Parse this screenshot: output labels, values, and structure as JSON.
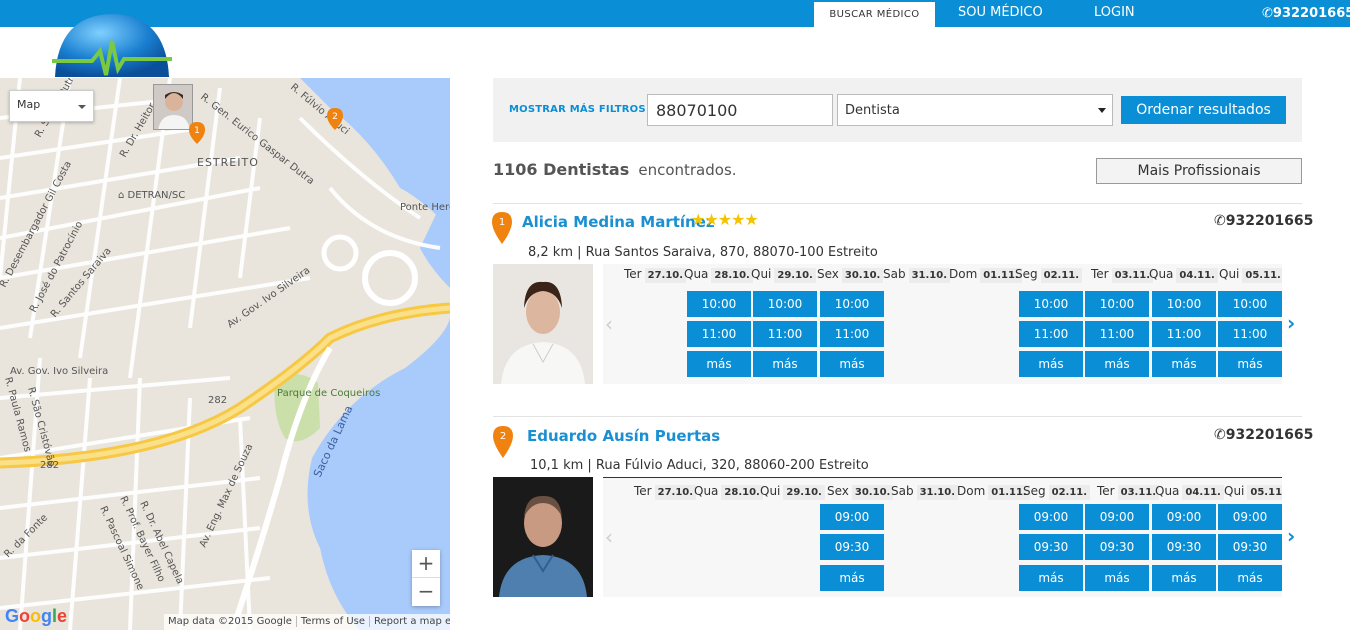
{
  "topnav": {
    "buscar": "BUSCAR MÉDICO",
    "sou": "SOU MÉDICO",
    "login": "LOGIN",
    "phone": "932201665"
  },
  "map": {
    "type_label": "Map",
    "zoom_in": "+",
    "zoom_out": "−",
    "google": "Google",
    "attribution": "Map data ©2015 Google",
    "terms": "Terms of Use",
    "report": "Report a map error",
    "labels": {
      "estreito": "ESTREITO",
      "detran": "DETRAN/SC",
      "ponte": "Ponte Hercílio",
      "ivo1": "Av. Gov. Ivo Silveira",
      "ivo2": "Av. Gov. Ivo Silveira",
      "gaspar": "R. Gen. Eurico Gaspar Dutra",
      "fulvio": "R. Fúlvio Aduci",
      "souza": "R. Souza Dutra",
      "helio": "R. Dr. Heitor",
      "desemb": "R. Desembargador Gil Costa",
      "patroc": "R. José do Patrocínio",
      "saraiva": "R. Santos Saraiva",
      "parque": "Parque de Coqueiros",
      "saco": "Saco da Lama",
      "r282a": "282",
      "r282b": "282",
      "paulo": "R. Paula Ramos",
      "sao": "R. São Cristóvão",
      "max": "Av. Eng. Max de Souza",
      "abel": "R. Dr. Abel Capela",
      "bayer": "R. Prof. Bayer Filho",
      "pascoal": "R. Pascoal Simone",
      "fonte": "R. da Fonte",
      "marker1": "1",
      "marker2": "2"
    }
  },
  "search": {
    "filtros": "MOSTRAR MÁS FILTROS",
    "zip": "88070100",
    "specialty": "Dentista",
    "ordenar": "Ordenar resultados"
  },
  "results": {
    "count": "1106 Dentistas",
    "found": "encontrados.",
    "mais": "Mais Profissionais"
  },
  "doctors": [
    {
      "num": "1",
      "name": "Alicia Medina Martínez",
      "stars": "★★★★★",
      "phone": "932201665",
      "address": "8,2 km | Rua Santos Saraiva, 870, 88070-100 Estreito",
      "days": [
        {
          "d": "Ter",
          "date": "27.10."
        },
        {
          "d": "Qua",
          "date": "28.10."
        },
        {
          "d": "Qui",
          "date": "29.10."
        },
        {
          "d": "Sex",
          "date": "30.10."
        },
        {
          "d": "Sab",
          "date": "31.10."
        },
        {
          "d": "Dom",
          "date": "01.11."
        },
        {
          "d": "Seg",
          "date": "02.11."
        },
        {
          "d": "Ter",
          "date": "03.11."
        },
        {
          "d": "Qua",
          "date": "04.11."
        },
        {
          "d": "Qui",
          "date": "05.11."
        }
      ],
      "slots": [
        "10:00",
        "11:00",
        "más"
      ]
    },
    {
      "num": "2",
      "name": "Eduardo Ausín Puertas",
      "phone": "932201665",
      "address": "10,1 km | Rua Fúlvio Aduci, 320, 88060-200 Estreito",
      "days": [
        {
          "d": "Ter",
          "date": "27.10."
        },
        {
          "d": "Qua",
          "date": "28.10."
        },
        {
          "d": "Qui",
          "date": "29.10."
        },
        {
          "d": "Sex",
          "date": "30.10."
        },
        {
          "d": "Sab",
          "date": "31.10."
        },
        {
          "d": "Dom",
          "date": "01.11."
        },
        {
          "d": "Seg",
          "date": "02.11."
        },
        {
          "d": "Ter",
          "date": "03.11."
        },
        {
          "d": "Qua",
          "date": "04.11."
        },
        {
          "d": "Qui",
          "date": "05.11."
        }
      ],
      "slots": [
        "09:00",
        "09:30",
        "más"
      ]
    }
  ],
  "colors": {
    "brand": "#0a8fd6",
    "marker": "#f0820f",
    "star": "#f4c400"
  }
}
